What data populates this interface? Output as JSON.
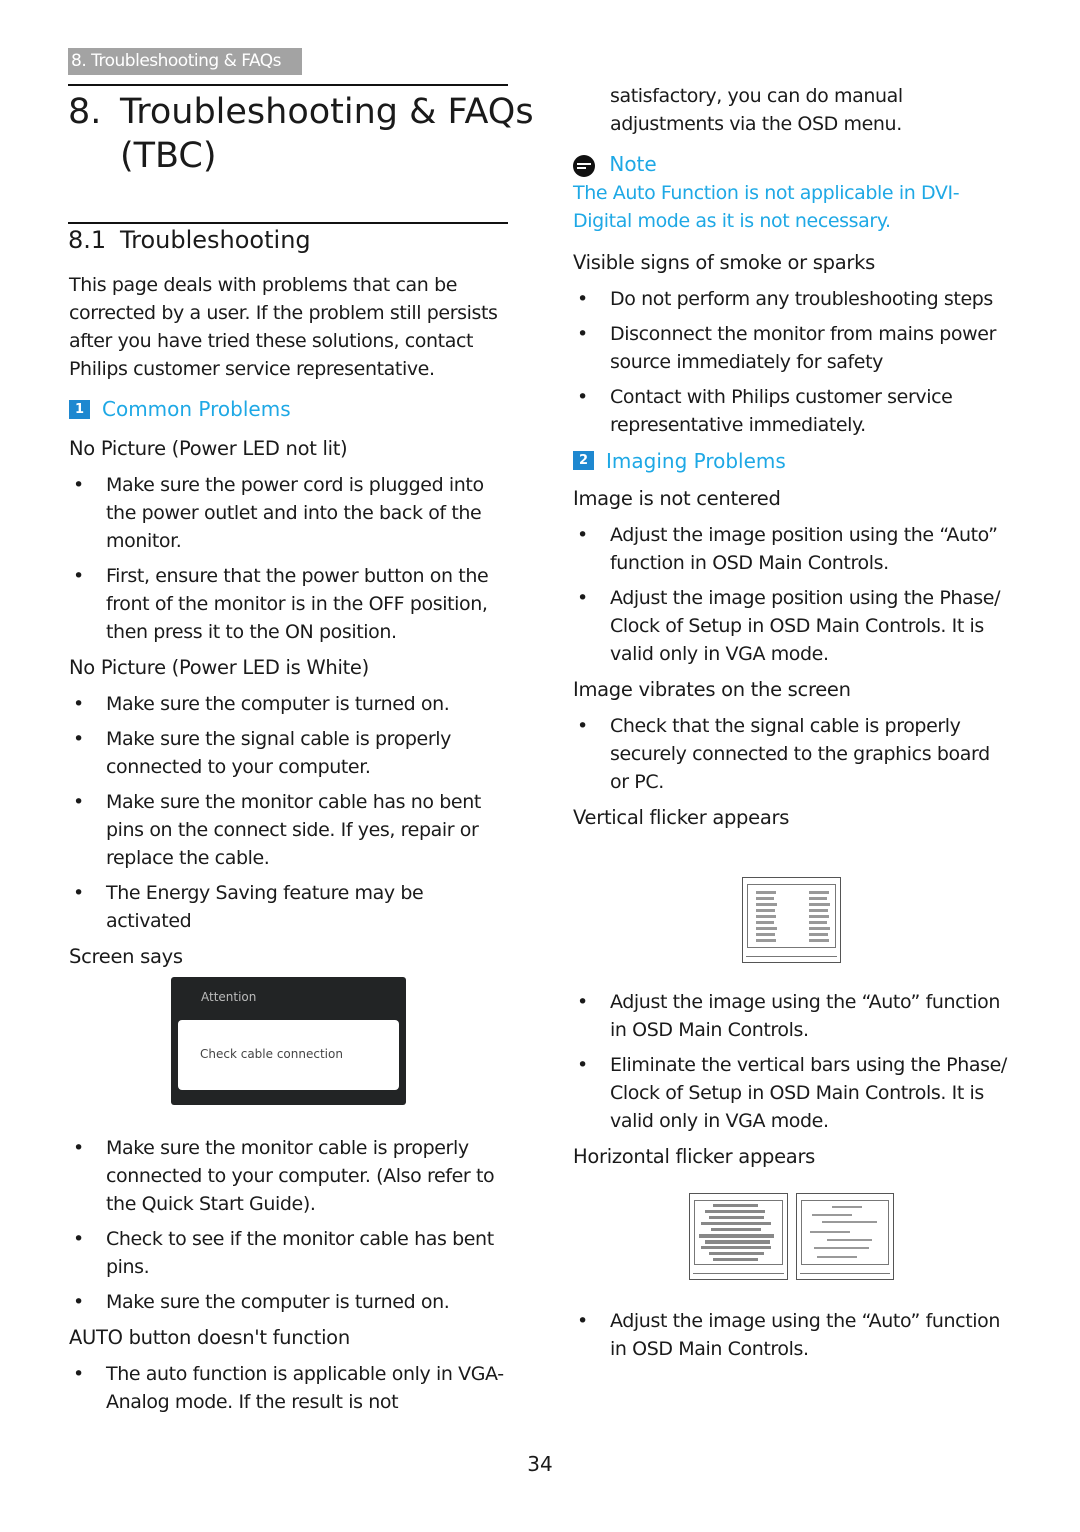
{
  "header_tag": "8. Troubleshooting & FAQs",
  "title": {
    "number": "8.",
    "line1": "Troubleshooting & FAQs",
    "line2": "(TBC)"
  },
  "section": {
    "number": "8.1",
    "title": "Troubleshooting"
  },
  "intro": "This page deals with problems that can be corrected by a user. If the problem still persists after you have tried these solutions, contact Philips customer service representative.",
  "common": {
    "badge": "1",
    "heading": "Common Problems",
    "groups": [
      {
        "title": "No Picture (Power LED not lit)",
        "items": [
          "Make sure the power cord is plugged into the power outlet and into the back of the monitor.",
          "First, ensure that the power button on the front of the monitor is in the OFF position, then press it to the ON position."
        ]
      },
      {
        "title": "No Picture (Power LED is White)",
        "items": [
          "Make sure the computer is turned on.",
          "Make sure the signal cable is properly connected to your computer.",
          "Make sure the monitor cable has no bent pins on the connect side. If yes, repair or replace the cable.",
          "The Energy Saving feature may be activated"
        ]
      },
      {
        "title": "Screen says",
        "items": []
      }
    ],
    "osd": {
      "title": "Attention",
      "message": "Check cable connection"
    },
    "screen_items": [
      "Make sure the monitor cable is properly connected to your computer. (Also refer to the Quick Start Guide).",
      "Check to see if the monitor cable has bent pins.",
      "Make sure the computer is turned on."
    ],
    "auto": {
      "title": "AUTO button doesn't function",
      "items": [
        "The auto function is applicable only in VGA-Analog mode.  If the result is not"
      ]
    }
  },
  "right": {
    "continuation": "satisfactory, you can do manual adjustments via the OSD menu.",
    "note": {
      "label": "Note",
      "text": "The Auto Function is not applicable in DVI-Digital mode as it is not necessary."
    },
    "smoke": {
      "title": "Visible signs of smoke or sparks",
      "items": [
        "Do not perform any troubleshooting steps",
        "Disconnect the monitor from mains power source immediately for safety",
        "Contact with Philips customer service representative immediately."
      ]
    },
    "imaging": {
      "badge": "2",
      "heading": "Imaging Problems"
    },
    "centered": {
      "title": "Image is not centered",
      "items": [
        "Adjust the image position using the “Auto” function in OSD Main Controls.",
        "Adjust the image position using the Phase/ Clock of Setup in OSD Main Controls.  It is valid only in VGA mode."
      ]
    },
    "vibrates": {
      "title": "Image vibrates on the screen",
      "items": [
        "Check that the signal cable is properly securely connected to the graphics board or PC."
      ]
    },
    "vertical": {
      "title": "Vertical flicker appears",
      "items": [
        "Adjust the image using the “Auto” function in OSD Main Controls.",
        "Eliminate the vertical bars using the Phase/ Clock of Setup in OSD Main Controls. It is valid only in VGA mode."
      ]
    },
    "horizontal": {
      "title": "Horizontal flicker appears",
      "items": [
        "Adjust the image using the “Auto” function in OSD Main Controls."
      ]
    }
  },
  "page_number": "34"
}
